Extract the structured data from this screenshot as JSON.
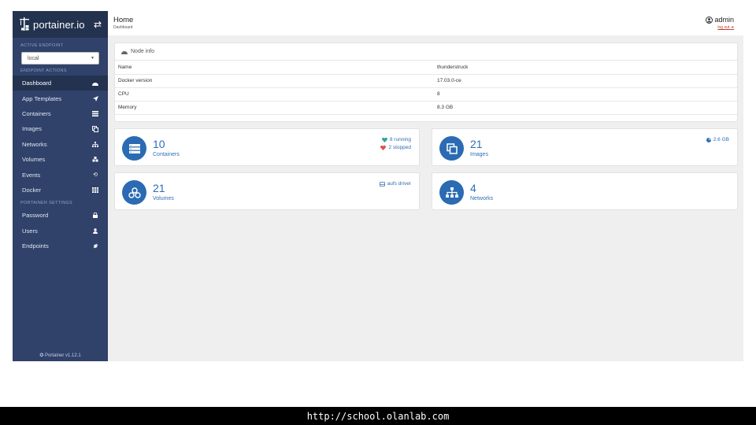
{
  "brand": {
    "name": "portainer.io",
    "logo_icon": "portainer-crane-icon",
    "toggle_icon": "exchange-icon"
  },
  "sidebar": {
    "active_endpoint_title": "ACTIVE ENDPOINT",
    "endpoint_value": "local",
    "endpoint_actions_title": "ENDPOINT ACTIONS",
    "actions": [
      {
        "label": "Dashboard",
        "icon": "tachometer-icon",
        "active": true
      },
      {
        "label": "App Templates",
        "icon": "rocket-icon"
      },
      {
        "label": "Containers",
        "icon": "server-icon"
      },
      {
        "label": "Images",
        "icon": "clone-icon"
      },
      {
        "label": "Networks",
        "icon": "sitemap-icon"
      },
      {
        "label": "Volumes",
        "icon": "cubes-icon"
      },
      {
        "label": "Events",
        "icon": "history-icon"
      },
      {
        "label": "Docker",
        "icon": "th-icon"
      }
    ],
    "settings_title": "PORTAINER SETTINGS",
    "settings": [
      {
        "label": "Password",
        "icon": "lock-icon"
      },
      {
        "label": "Users",
        "icon": "user-icon"
      },
      {
        "label": "Endpoints",
        "icon": "plug-icon"
      }
    ],
    "footer": "Portainer v1.12.1"
  },
  "header": {
    "title": "Home",
    "breadcrumb": "Dashboard",
    "user": "admin",
    "logout": "log out"
  },
  "node_info": {
    "title": "Node info",
    "rows": [
      {
        "key": "Name",
        "value": "thunderstruck"
      },
      {
        "key": "Docker version",
        "value": "17.03.0-ce"
      },
      {
        "key": "CPU",
        "value": "8"
      },
      {
        "key": "Memory",
        "value": "8.3 GB"
      }
    ]
  },
  "stats": {
    "containers": {
      "count": "10",
      "label": "Containers",
      "running": "8 running",
      "stopped": "2 stopped"
    },
    "images": {
      "count": "21",
      "label": "Images",
      "size": "2.6 GB"
    },
    "volumes": {
      "count": "21",
      "label": "Volumes",
      "driver": "aufs driver"
    },
    "networks": {
      "count": "4",
      "label": "Networks"
    }
  },
  "colors": {
    "sidebar": "#30426a",
    "sidebar_dark": "#23324f",
    "accent": "#2a6bb3",
    "running": "#2fa4a0",
    "stopped": "#d9534f"
  },
  "banner": "http://school.olanlab.com"
}
